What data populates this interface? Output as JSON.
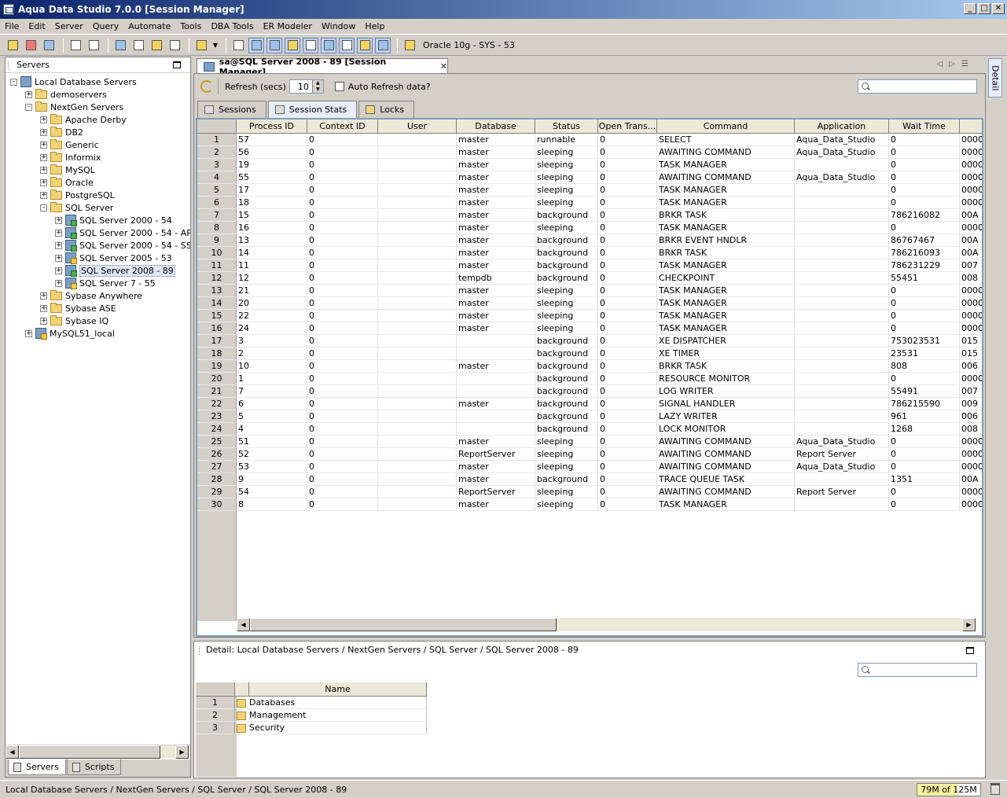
{
  "window": {
    "title": "Aqua Data Studio 7.0.0 [Session Manager]"
  },
  "menu": [
    "File",
    "Edit",
    "Server",
    "Query",
    "Automate",
    "Tools",
    "DBA Tools",
    "ER Modeler",
    "Window",
    "Help"
  ],
  "toolbar": {
    "connection": "Oracle 10g - SYS - 53"
  },
  "servers_panel": {
    "title": "Servers",
    "tree": [
      {
        "label": "Local Database Servers",
        "level": 0,
        "type": "db",
        "exp": "-"
      },
      {
        "label": "demoservers",
        "level": 1,
        "type": "folder",
        "exp": "+"
      },
      {
        "label": "NextGen Servers",
        "level": 1,
        "type": "folder",
        "exp": "-"
      },
      {
        "label": "Apache Derby",
        "level": 2,
        "type": "folder",
        "exp": "+"
      },
      {
        "label": "DB2",
        "level": 2,
        "type": "folder",
        "exp": "+"
      },
      {
        "label": "Generic",
        "level": 2,
        "type": "folder",
        "exp": "+"
      },
      {
        "label": "Informix",
        "level": 2,
        "type": "folder",
        "exp": "+"
      },
      {
        "label": "MySQL",
        "level": 2,
        "type": "folder",
        "exp": "+"
      },
      {
        "label": "Oracle",
        "level": 2,
        "type": "folder",
        "exp": "+"
      },
      {
        "label": "PostgreSQL",
        "level": 2,
        "type": "folder",
        "exp": "+"
      },
      {
        "label": "SQL Server",
        "level": 2,
        "type": "folder",
        "exp": "-"
      },
      {
        "label": "SQL Server 2000 - 54",
        "level": 3,
        "type": "server-ok",
        "exp": "+"
      },
      {
        "label": "SQL Server 2000 - 54 - API-",
        "level": 3,
        "type": "server-ok",
        "exp": "+"
      },
      {
        "label": "SQL Server 2000 - 54 - SSO",
        "level": 3,
        "type": "server-ok",
        "exp": "+"
      },
      {
        "label": "SQL Server 2005 - 53",
        "level": 3,
        "type": "server-warn",
        "exp": "+"
      },
      {
        "label": "SQL Server 2008 - 89",
        "level": 3,
        "type": "server-ok",
        "exp": "+",
        "selected": true
      },
      {
        "label": "SQL Server 7 - 55",
        "level": 3,
        "type": "server-warn",
        "exp": "+"
      },
      {
        "label": "Sybase Anywhere",
        "level": 2,
        "type": "folder",
        "exp": "+"
      },
      {
        "label": "Sybase ASE",
        "level": 2,
        "type": "folder",
        "exp": "+"
      },
      {
        "label": "Sybase IQ",
        "level": 2,
        "type": "folder",
        "exp": "+"
      },
      {
        "label": "MySQL51_local",
        "level": 1,
        "type": "server-warn",
        "exp": "+"
      }
    ],
    "tabs": [
      "Servers",
      "Scripts"
    ]
  },
  "editor": {
    "tab_title": "sa@SQL Server 2008 - 89 [Session Manager]",
    "refresh_label": "Refresh (secs)",
    "refresh_value": "10",
    "auto_refresh_label": "Auto Refresh data?",
    "subtabs": [
      "Sessions",
      "Session Stats",
      "Locks"
    ],
    "active_subtab": 1,
    "columns": [
      "Process ID",
      "Context ID",
      "User",
      "Database",
      "Status",
      "Open Trans...",
      "Command",
      "Application",
      "Wait Time"
    ],
    "rows": [
      [
        "57",
        "0",
        "",
        "master",
        "runnable",
        "0",
        "SELECT",
        "Aqua_Data_Studio",
        "0",
        "0000"
      ],
      [
        "56",
        "0",
        "",
        "master",
        "sleeping",
        "0",
        "AWAITING COMMAND",
        "Aqua_Data_Studio",
        "0",
        "0000"
      ],
      [
        "19",
        "0",
        "",
        "master",
        "sleeping",
        "0",
        "TASK MANAGER",
        "",
        "0",
        "0000"
      ],
      [
        "55",
        "0",
        "",
        "master",
        "sleeping",
        "0",
        "AWAITING COMMAND",
        "Aqua_Data_Studio",
        "0",
        "0000"
      ],
      [
        "17",
        "0",
        "",
        "master",
        "sleeping",
        "0",
        "TASK MANAGER",
        "",
        "0",
        "0000"
      ],
      [
        "18",
        "0",
        "",
        "master",
        "sleeping",
        "0",
        "TASK MANAGER",
        "",
        "0",
        "0000"
      ],
      [
        "15",
        "0",
        "",
        "master",
        "background",
        "0",
        "BRKR TASK",
        "",
        "786216082",
        "00A"
      ],
      [
        "16",
        "0",
        "",
        "master",
        "sleeping",
        "0",
        "TASK MANAGER",
        "",
        "0",
        "0000"
      ],
      [
        "13",
        "0",
        "",
        "master",
        "background",
        "0",
        "BRKR EVENT HNDLR",
        "",
        "86767467",
        "00A"
      ],
      [
        "14",
        "0",
        "",
        "master",
        "background",
        "0",
        "BRKR TASK",
        "",
        "786216093",
        "00A"
      ],
      [
        "11",
        "0",
        "",
        "master",
        "background",
        "0",
        "TASK MANAGER",
        "",
        "786231229",
        "007"
      ],
      [
        "12",
        "0",
        "",
        "tempdb",
        "background",
        "0",
        "CHECKPOINT",
        "",
        "55451",
        "008"
      ],
      [
        "21",
        "0",
        "",
        "master",
        "sleeping",
        "0",
        "TASK MANAGER",
        "",
        "0",
        "0000"
      ],
      [
        "20",
        "0",
        "",
        "master",
        "sleeping",
        "0",
        "TASK MANAGER",
        "",
        "0",
        "0000"
      ],
      [
        "22",
        "0",
        "",
        "master",
        "sleeping",
        "0",
        "TASK MANAGER",
        "",
        "0",
        "0000"
      ],
      [
        "24",
        "0",
        "",
        "master",
        "sleeping",
        "0",
        "TASK MANAGER",
        "",
        "0",
        "0000"
      ],
      [
        "3",
        "0",
        "",
        "",
        "background",
        "0",
        "XE DISPATCHER",
        "",
        "753023531",
        "015"
      ],
      [
        "2",
        "0",
        "",
        "",
        "background",
        "0",
        "XE TIMER",
        "",
        "23531",
        "015"
      ],
      [
        "10",
        "0",
        "",
        "master",
        "background",
        "0",
        "BRKR TASK",
        "",
        "808",
        "006"
      ],
      [
        "1",
        "0",
        "",
        "",
        "background",
        "0",
        "RESOURCE MONITOR",
        "",
        "0",
        "0000"
      ],
      [
        "7",
        "0",
        "",
        "",
        "background",
        "0",
        "LOG WRITER",
        "",
        "55491",
        "007"
      ],
      [
        "6",
        "0",
        "",
        "master",
        "background",
        "0",
        "SIGNAL HANDLER",
        "",
        "786215590",
        "009"
      ],
      [
        "5",
        "0",
        "",
        "",
        "background",
        "0",
        "LAZY WRITER",
        "",
        "961",
        "006"
      ],
      [
        "4",
        "0",
        "",
        "",
        "background",
        "0",
        "LOCK MONITOR",
        "",
        "1268",
        "008"
      ],
      [
        "51",
        "0",
        "",
        "master",
        "sleeping",
        "0",
        "AWAITING COMMAND",
        "Aqua_Data_Studio",
        "0",
        "0000"
      ],
      [
        "52",
        "0",
        "",
        "ReportServer",
        "sleeping",
        "0",
        "AWAITING COMMAND",
        "Report Server",
        "0",
        "0000"
      ],
      [
        "53",
        "0",
        "",
        "master",
        "sleeping",
        "0",
        "AWAITING COMMAND",
        "Aqua_Data_Studio",
        "0",
        "0000"
      ],
      [
        "9",
        "0",
        "",
        "master",
        "background",
        "0",
        "TRACE QUEUE TASK",
        "",
        "1351",
        "00A"
      ],
      [
        "54",
        "0",
        "",
        "ReportServer",
        "sleeping",
        "0",
        "AWAITING COMMAND",
        "Report Server",
        "0",
        "0000"
      ],
      [
        "8",
        "0",
        "",
        "master",
        "sleeping",
        "0",
        "TASK MANAGER",
        "",
        "0",
        "0000"
      ]
    ]
  },
  "detail": {
    "title": "Detail: Local Database Servers / NextGen Servers / SQL Server / SQL Server 2008 - 89",
    "column": "Name",
    "rows": [
      "Databases",
      "Management",
      "Security"
    ],
    "side_tab": "Detail"
  },
  "status": {
    "path": "Local Database Servers / NextGen Servers / SQL Server / SQL Server 2008 - 89",
    "memory": "79M of 125M",
    "memory_fraction": 0.632
  }
}
